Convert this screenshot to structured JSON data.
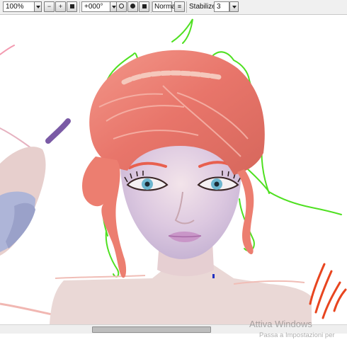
{
  "toolbar": {
    "zoom": "100%",
    "rotation": "+000°",
    "blend_mode": "Normal",
    "stabilizer_label": "Stabilizer",
    "stabilizer_value": "3",
    "icons": [
      "zoom-dropdown-icon",
      "zoom-out-icon",
      "zoom-in-icon",
      "zoom-reset-icon",
      "rotation-dropdown-icon",
      "rotate-left-icon",
      "rotate-right-icon",
      "rotate-reset-icon",
      "flip-horizontal-icon",
      "stabilizer-dropdown-icon"
    ]
  },
  "watermark": {
    "title": "Attiva Windows",
    "subtitle": "Passa a Impostazioni per"
  },
  "colors": {
    "hair": "#ec7e70",
    "skin": "#ead8d6",
    "sketch_green": "#4fe021",
    "sketch_red": "#e8451f"
  }
}
